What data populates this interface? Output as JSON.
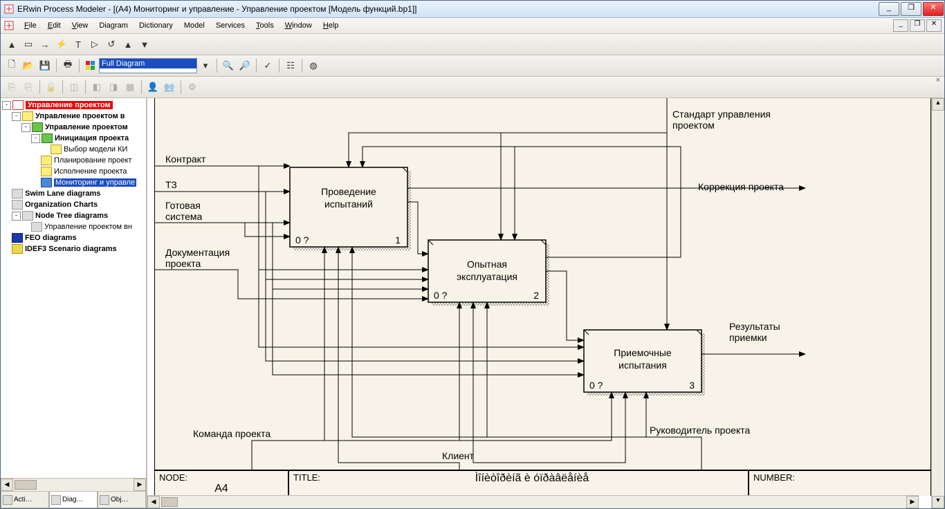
{
  "title": "ERwin Process Modeler - [(A4) Мониторинг и управление - Управление проектом  [Модель функций.bp1]]",
  "menu": {
    "file": "File",
    "edit": "Edit",
    "view": "View",
    "diagram": "Diagram",
    "dictionary": "Dictionary",
    "model": "Model",
    "services": "Services",
    "tools": "Tools",
    "window": "Window",
    "help": "Help"
  },
  "toolbar": {
    "view_combo": "Full Diagram"
  },
  "tree": {
    "root": "Управление проектом",
    "n1": "Управление проектом в",
    "n2": "Управление проектом",
    "n3": "Инициация проекта",
    "n4": "Выбор модели  КИ",
    "n5": "Планирование проект",
    "n6": "Исполнение проекта",
    "n7": "Мониторинг и управле",
    "n8": "Swim Lane diagrams",
    "n9": "Organization Charts",
    "n10": "Node Tree diagrams",
    "n11": "Управление проектом вн",
    "n12": "FEO diagrams",
    "n13": "IDEF3 Scenario diagrams"
  },
  "side_tabs": {
    "t1": "Acti…",
    "t2": "Diag…",
    "t3": "Obj…"
  },
  "diagram": {
    "inputs": {
      "i1": "Контракт",
      "i2": "ТЗ",
      "i3_a": "Готовая",
      "i3_b": "система",
      "i4_a": "Документация",
      "i4_b": "проекта"
    },
    "controls": {
      "c1_a": "Стандарт управления",
      "c1_b": "проектом"
    },
    "mechs": {
      "m1": "Команда проекта",
      "m2": "Клиент",
      "m3": "Руководитель проекта"
    },
    "outputs": {
      "o1": "Коррекция проекта",
      "o2_a": "Результаты",
      "o2_b": "приемки"
    },
    "box1": {
      "t1": "Проведение",
      "t2": "испытаний",
      "bl": "0 ?",
      "br": "1"
    },
    "box2": {
      "t1": "Опытная",
      "t2": "эксплуатация",
      "bl": "0 ?",
      "br": "2"
    },
    "box3": {
      "t1": "Приемочные",
      "t2": "испытания",
      "bl": "0 ?",
      "br": "3"
    }
  },
  "footer": {
    "node_lab": "NODE:",
    "node_val": "A4",
    "title_lab": "TITLE:",
    "title_val": "Ìîíèòîðèíã è óïðàâëåíèå",
    "number_lab": "NUMBER:"
  }
}
